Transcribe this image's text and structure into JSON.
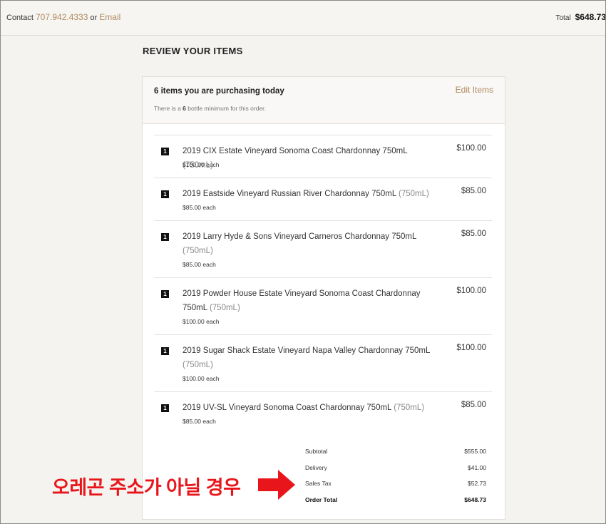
{
  "header": {
    "contact_label": "Contact",
    "phone": "707.942.4333",
    "or_label": "or",
    "email": "Email",
    "total_label": "Total",
    "total_value": "$648.73"
  },
  "page_title": "REVIEW YOUR ITEMS",
  "card": {
    "items_title": "6 items you are purchasing today",
    "edit_label": "Edit Items",
    "minimum_prefix": "There is a",
    "minimum_count": "6",
    "minimum_suffix": "bottle minimum for this order."
  },
  "items": [
    {
      "qty": "1",
      "name": "2019 CIX Estate Vineyard Sonoma Coast Chardonnay 750mL",
      "size": "(750mL)",
      "each": "$100.00 each",
      "price": "$100.00"
    },
    {
      "qty": "1",
      "name": "2019 Eastside Vineyard Russian River Chardonnay 750mL",
      "size": "(750mL)",
      "each": "$85.00 each",
      "price": "$85.00"
    },
    {
      "qty": "1",
      "name": "2019 Larry Hyde & Sons Vineyard Carneros Chardonnay 750mL",
      "size": "(750mL)",
      "each": "$85.00 each",
      "price": "$85.00"
    },
    {
      "qty": "1",
      "name": "2019 Powder House Estate Vineyard Sonoma Coast Chardonnay 750mL",
      "size": "(750mL)",
      "each": "$100.00 each",
      "price": "$100.00"
    },
    {
      "qty": "1",
      "name": "2019 Sugar Shack Estate Vineyard Napa Valley Chardonnay 750mL",
      "size": "(750mL)",
      "each": "$100.00 each",
      "price": "$100.00"
    },
    {
      "qty": "1",
      "name": "2019 UV-SL Vineyard Sonoma Coast Chardonnay 750mL",
      "size": "(750mL)",
      "each": "$85.00 each",
      "price": "$85.00"
    }
  ],
  "totals": {
    "subtotal_label": "Subtotal",
    "subtotal": "$555.00",
    "delivery_label": "Delivery",
    "delivery": "$41.00",
    "tax_label": "Sales Tax",
    "tax": "$52.73",
    "order_total_label": "Order Total",
    "order_total": "$648.73"
  },
  "annotation": "오레곤 주소가 아닐 경우",
  "colors": {
    "accent": "#b08a5e",
    "annotation": "#e8161b",
    "background": "#f4f3f0"
  }
}
